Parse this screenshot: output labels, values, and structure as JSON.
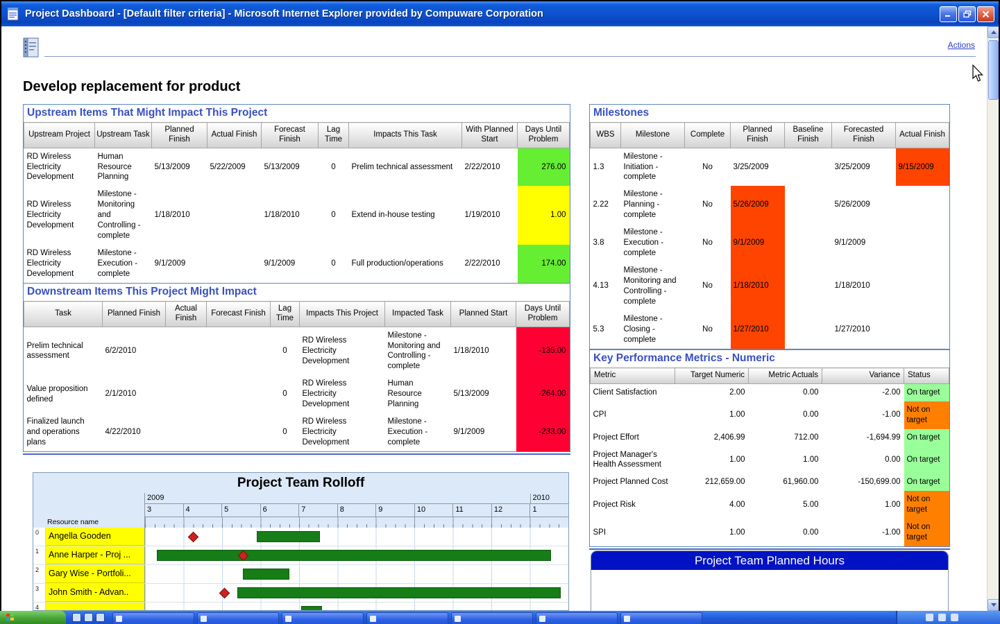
{
  "colors": {
    "section_title": "#3a50c0",
    "link_blue": "#2a40c8",
    "green_cell": "#66ee33",
    "yellow_cell": "#ffff00",
    "red_cell": "#ff0033",
    "milestone_overdue": "#ff4400",
    "status_on_target": "#99ff99",
    "status_not_on_target": "#ff8000",
    "gantt_bar": "#177d17",
    "gantt_diamond": "#cc2222",
    "hours_header": "#0013c4"
  },
  "window": {
    "title": "Project Dashboard - [Default filter criteria] - Microsoft Internet Explorer provided by Compuware Corporation"
  },
  "header": {
    "actions": "Actions"
  },
  "page": {
    "title": "Develop replacement for product"
  },
  "upstream": {
    "title": "Upstream Items That Might Impact This Project",
    "columns": [
      "Upstream Project",
      "Upstream Task",
      "Planned Finish",
      "Actual Finish",
      "Forecast Finish",
      "Lag Time",
      "Impacts This Task",
      "With Planned Start",
      "Days Until Problem"
    ],
    "rows": [
      {
        "project": "RD Wireless Electricity Development",
        "task": "Human Resource Planning",
        "planned": "5/13/2009",
        "actual": "5/22/2009",
        "forecast": "5/13/2009",
        "lag": "0",
        "impacts": "Prelim technical assessment",
        "start": "2/22/2010",
        "days": "276.00",
        "days_class": "cell-green"
      },
      {
        "project": "RD Wireless Electricity Development",
        "task": "Milestone - Monitoring and Controlling - complete",
        "planned": "1/18/2010",
        "actual": "",
        "forecast": "1/18/2010",
        "lag": "0",
        "impacts": "Extend in-house testing",
        "start": "1/19/2010",
        "days": "1.00",
        "days_class": "cell-yellow"
      },
      {
        "project": "RD Wireless Electricity Development",
        "task": "Milestone - Execution - complete",
        "planned": "9/1/2009",
        "actual": "",
        "forecast": "9/1/2009",
        "lag": "0",
        "impacts": "Full production/operations",
        "start": "2/22/2010",
        "days": "174.00",
        "days_class": "cell-green"
      }
    ]
  },
  "downstream": {
    "title": "Downstream Items This Project Might Impact",
    "columns": [
      "Task",
      "Planned Finish",
      "Actual Finish",
      "Forecast Finish",
      "Lag Time",
      "Impacts This Project",
      "Impacted Task",
      "Planned Start",
      "Days Until Problem"
    ],
    "rows": [
      {
        "task": "Prelim technical assessment",
        "planned": "6/2/2010",
        "actual": "",
        "forecast": "",
        "lag": "0",
        "project": "RD Wireless Electricity Development",
        "impacted": "Milestone - Monitoring and Controlling - complete",
        "start": "1/18/2010",
        "days": "-135.00",
        "days_class": "cell-red"
      },
      {
        "task": "Value proposition defined",
        "planned": "2/1/2010",
        "actual": "",
        "forecast": "",
        "lag": "0",
        "project": "RD Wireless Electricity Development",
        "impacted": "Human Resource Planning",
        "start": "5/13/2009",
        "days": "-264.00",
        "days_class": "cell-red"
      },
      {
        "task": "Finalized launch and operations plans",
        "planned": "4/22/2010",
        "actual": "",
        "forecast": "",
        "lag": "0",
        "project": "RD Wireless Electricity Development",
        "impacted": "Milestone - Execution - complete",
        "start": "9/1/2009",
        "days": "-233.00",
        "days_class": "cell-red"
      }
    ]
  },
  "milestones": {
    "title": "Milestones",
    "columns": [
      "WBS",
      "Milestone",
      "Complete",
      "Planned Finish",
      "Baseline Finish",
      "Forecasted Finish",
      "Actual Finish"
    ],
    "rows": [
      {
        "wbs": "1.3",
        "name": "Milestone - Initiation - complete",
        "complete": "No",
        "planned": "3/25/2009",
        "baseline": "",
        "forecasted": "3/25/2009",
        "actual": "9/15/2009",
        "planned_class": "",
        "actual_class": "cell-overdue"
      },
      {
        "wbs": "2.22",
        "name": "Milestone - Planning - complete",
        "complete": "No",
        "planned": "5/26/2009",
        "baseline": "",
        "forecasted": "5/26/2009",
        "actual": "",
        "planned_class": "cell-overdue",
        "actual_class": ""
      },
      {
        "wbs": "3.8",
        "name": "Milestone - Execution - complete",
        "complete": "No",
        "planned": "9/1/2009",
        "baseline": "",
        "forecasted": "9/1/2009",
        "actual": "",
        "planned_class": "cell-overdue",
        "actual_class": ""
      },
      {
        "wbs": "4.13",
        "name": "Milestone - Monitoring and Controlling - complete",
        "complete": "No",
        "planned": "1/18/2010",
        "baseline": "",
        "forecasted": "1/18/2010",
        "actual": "",
        "planned_class": "cell-overdue",
        "actual_class": ""
      },
      {
        "wbs": "5.3",
        "name": "Milestone - Closing - complete",
        "complete": "No",
        "planned": "1/27/2010",
        "baseline": "",
        "forecasted": "1/27/2010",
        "actual": "",
        "planned_class": "cell-overdue",
        "actual_class": ""
      }
    ]
  },
  "kpm": {
    "title": "Key Performance Metrics - Numeric",
    "columns": [
      "Metric",
      "Target Numeric",
      "Metric Actuals",
      "Variance",
      "Status"
    ],
    "rows": [
      {
        "metric": "Client Satisfaction",
        "target": "2.00",
        "actuals": "0.00",
        "variance": "-2.00",
        "status": "On target",
        "status_class": "status-on"
      },
      {
        "metric": "CPI",
        "target": "1.00",
        "actuals": "0.00",
        "variance": "-1.00",
        "status": "Not on target",
        "status_class": "status-off"
      },
      {
        "metric": "Project Effort",
        "target": "2,406.99",
        "actuals": "712.00",
        "variance": "-1,694.99",
        "status": "On target",
        "status_class": "status-on"
      },
      {
        "metric": "Project Manager's Health Assessment",
        "target": "1.00",
        "actuals": "1.00",
        "variance": "0.00",
        "status": "On target",
        "status_class": "status-on"
      },
      {
        "metric": "Project Planned Cost",
        "target": "212,659.00",
        "actuals": "61,960.00",
        "variance": "-150,699.00",
        "status": "On target",
        "status_class": "status-on"
      },
      {
        "metric": "Project Risk",
        "target": "4.00",
        "actuals": "5.00",
        "variance": "1.00",
        "status": "Not on target",
        "status_class": "status-off"
      },
      {
        "metric": "SPI",
        "target": "1.00",
        "actuals": "0.00",
        "variance": "-1.00",
        "status": "Not on target",
        "status_class": "status-off"
      }
    ]
  },
  "gantt": {
    "title": "Project Team Rolloff",
    "resource_label": "Resource name",
    "years": [
      "2009",
      "2010"
    ],
    "months": [
      "3",
      "4",
      "5",
      "6",
      "7",
      "8",
      "9",
      "10",
      "11",
      "12",
      "1"
    ],
    "axis": {
      "start": 3,
      "end": 14
    },
    "resources": [
      {
        "index": "0",
        "name": "Angella Gooden",
        "bar": [
          5.9,
          7.55
        ],
        "diamond": 4.25
      },
      {
        "index": "1",
        "name": "Anne Harper - Proj ...",
        "bar": [
          3.3,
          13.55
        ],
        "diamond": 5.55
      },
      {
        "index": "2",
        "name": "Gary Wise - Portfoli...",
        "bar": [
          5.55,
          6.75
        ],
        "diamond": null
      },
      {
        "index": "3",
        "name": "John Smith - Advan..",
        "bar": [
          5.4,
          13.8
        ],
        "diamond": 5.05
      },
      {
        "index": "4",
        "name": "",
        "bar": [
          7.05,
          7.6
        ],
        "diamond": null
      }
    ]
  },
  "planned_hours": {
    "title": "Project Team Planned Hours"
  }
}
